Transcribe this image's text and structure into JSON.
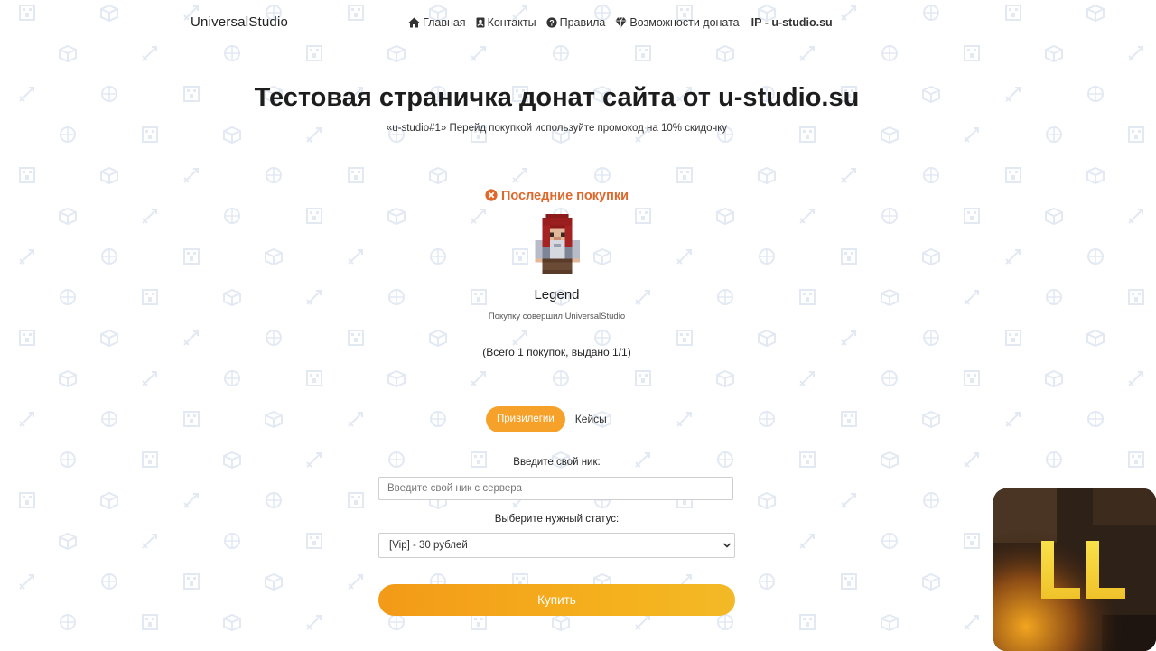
{
  "header": {
    "brand": "UniversalStudio",
    "nav": [
      {
        "label": "Главная",
        "icon": "home-icon"
      },
      {
        "label": "Контакты",
        "icon": "contact-card-icon"
      },
      {
        "label": "Правила",
        "icon": "question-circle-icon"
      },
      {
        "label": "Возможности доната",
        "icon": "diamond-icon"
      }
    ],
    "ip": "IP - u-studio.su"
  },
  "hero": {
    "title": "Тестовая страничка донат сайта от u-studio.su",
    "subtitle": "«u-studio#1» Перейд покупкой используйте промокод на 10% скидочку"
  },
  "recent": {
    "title": "Последние покупки",
    "icon": "close-circle-icon",
    "item": {
      "nick": "Legend",
      "note": "Покупку совершил UniversalStudio"
    },
    "total": "(Всего 1 покупок, выдано 1/1)"
  },
  "tabs": [
    {
      "label": "Привилегии",
      "active": true
    },
    {
      "label": "Кейсы",
      "active": false
    }
  ],
  "form": {
    "nick_label": "Введите свой ник:",
    "nick_placeholder": "Введите свой ник с сервера",
    "status_label": "Выберите нужный статус:",
    "status_selected": "[Vip] - 30 рублей",
    "buy_label": "Купить"
  },
  "colors": {
    "accent": "#f5a12a",
    "recent_title": "#e0672a"
  }
}
